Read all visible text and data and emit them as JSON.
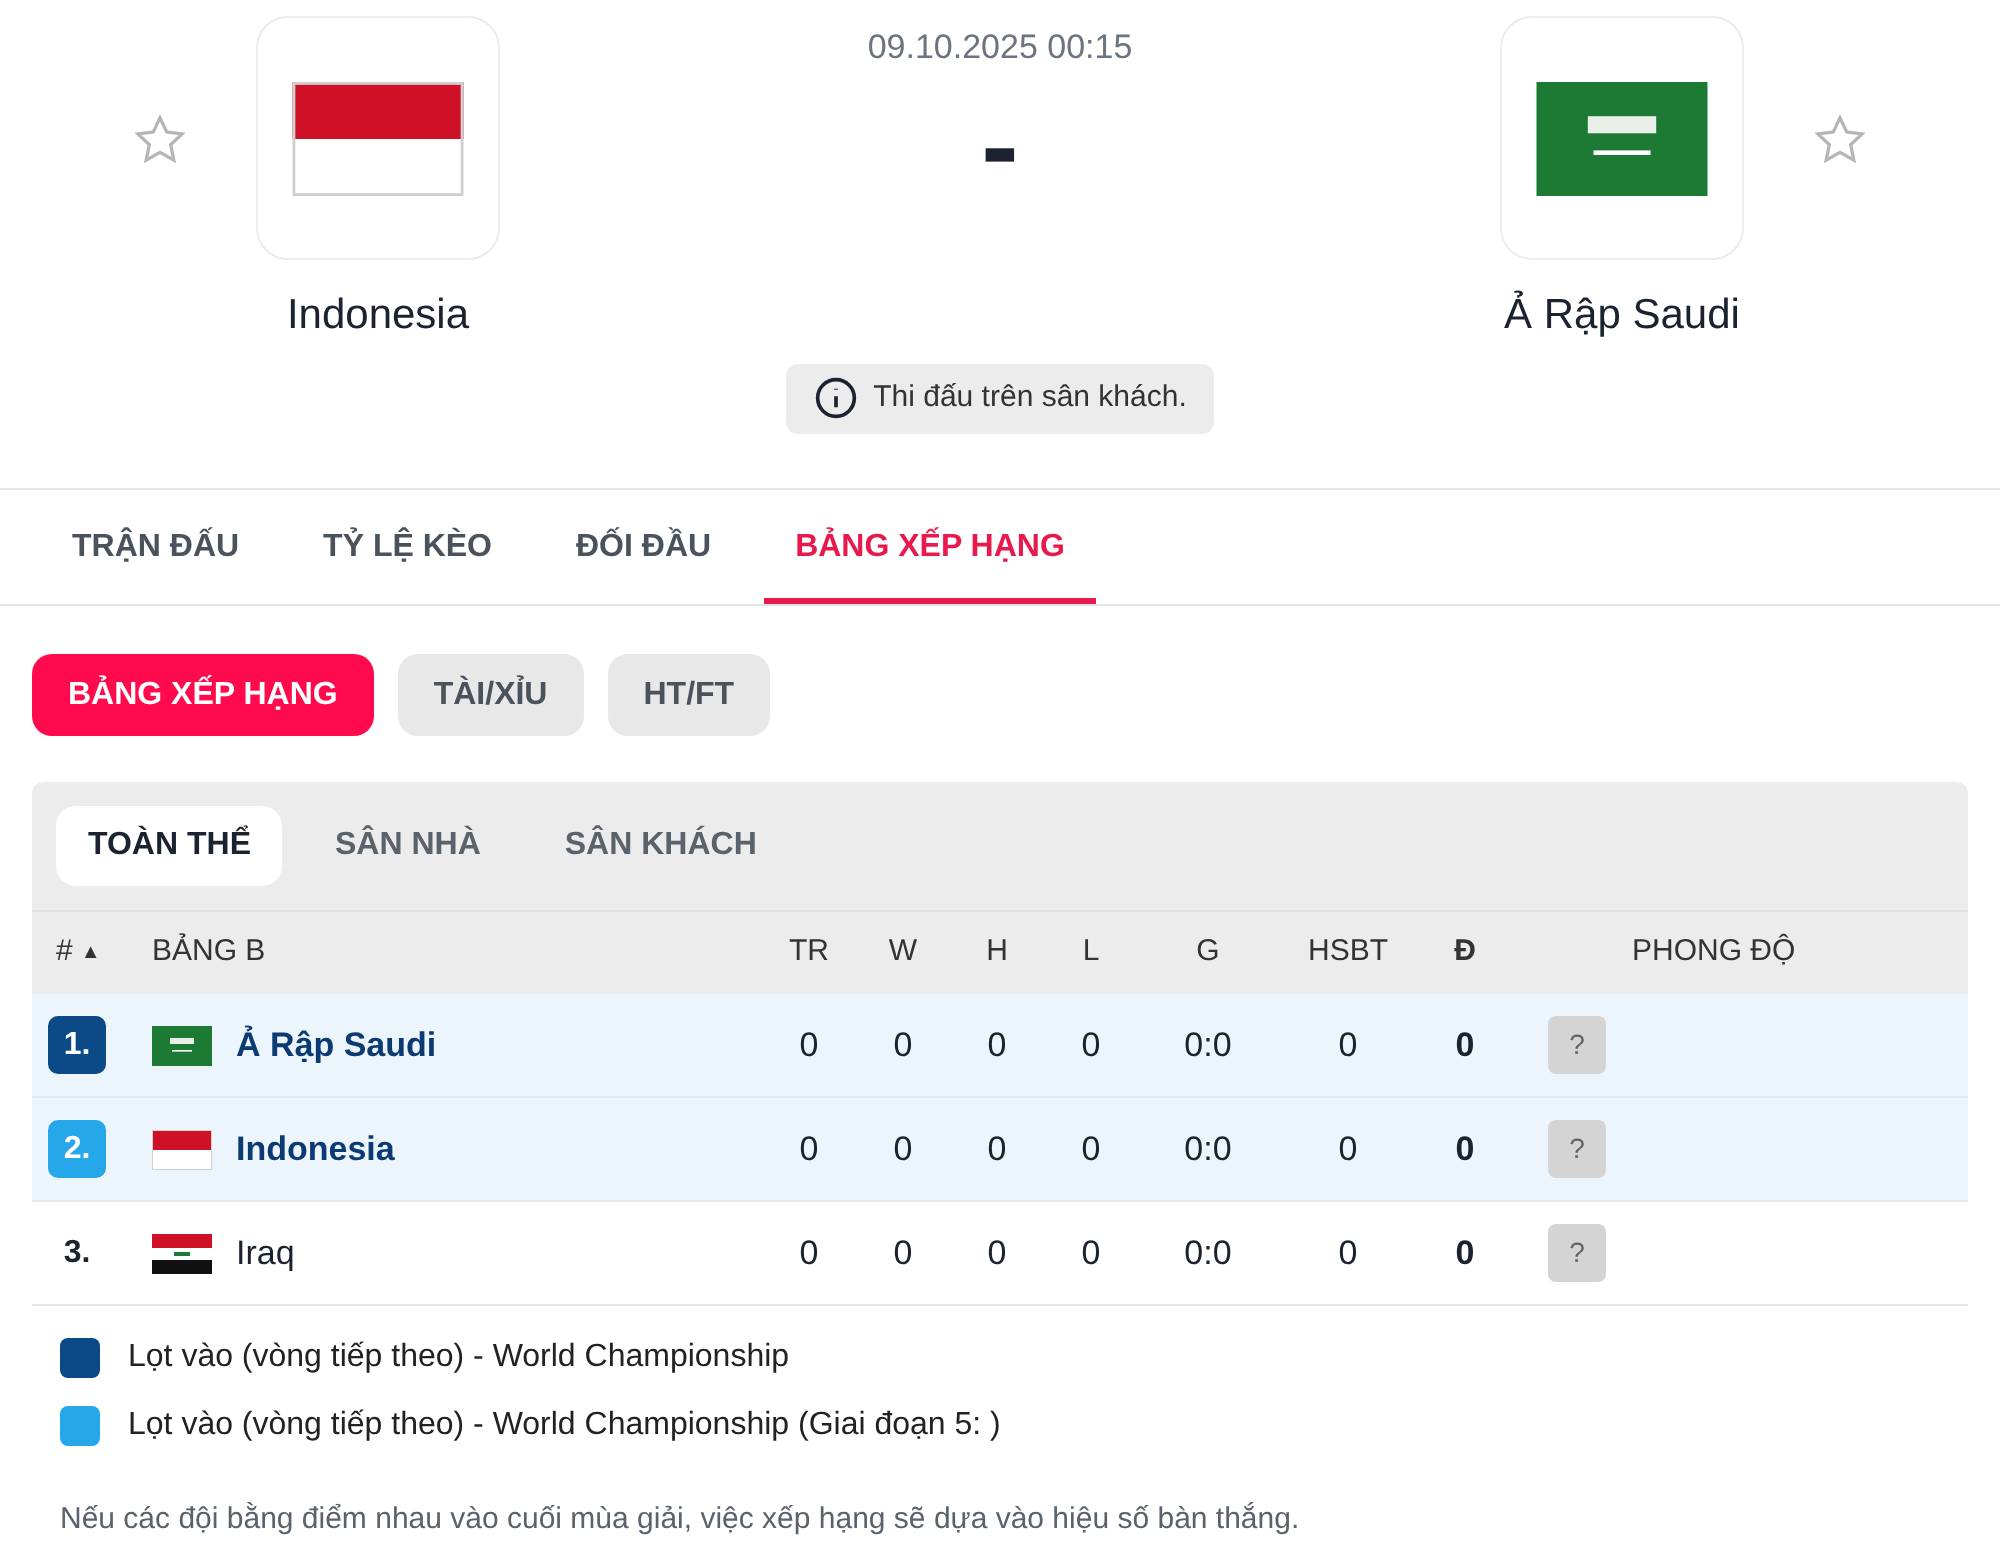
{
  "match": {
    "datetime": "09.10.2025 00:15",
    "score": "-",
    "home": {
      "name": "Indonesia",
      "flag": {
        "kind": "indonesia"
      },
      "favorite": false
    },
    "away": {
      "name": "Ả Rập Saudi",
      "flag": {
        "kind": "saudi"
      },
      "favorite": false
    },
    "info": "Thi đấu trên sân khách."
  },
  "tabs": [
    {
      "label": "TRẬN ĐẤU",
      "selected": false
    },
    {
      "label": "TỶ LỆ KÈO",
      "selected": false
    },
    {
      "label": "ĐỐI ĐẦU",
      "selected": false
    },
    {
      "label": "BẢNG XẾP HẠNG",
      "selected": true
    }
  ],
  "pills": [
    {
      "label": "BẢNG XẾP HẠNG",
      "selected": true
    },
    {
      "label": "TÀI/XỈU",
      "selected": false
    },
    {
      "label": "HT/FT",
      "selected": false
    }
  ],
  "subtabs": [
    {
      "label": "TOÀN THỂ",
      "selected": true
    },
    {
      "label": "SÂN NHÀ",
      "selected": false
    },
    {
      "label": "SÂN KHÁCH",
      "selected": false
    }
  ],
  "table": {
    "rank_header": "#",
    "sort_indicator": "▲",
    "group": "BẢNG B",
    "columns": [
      "TR",
      "W",
      "H",
      "L",
      "G",
      "HSBT",
      "Đ"
    ],
    "form_header": "PHONG ĐỘ",
    "rows": [
      {
        "rank": "1.",
        "color": "#0c4a87",
        "highlighted": true,
        "flag": {
          "kind": "saudi"
        },
        "team": "Ả Rập Saudi",
        "values": [
          "0",
          "0",
          "0",
          "0",
          "0:0",
          "0",
          "0"
        ],
        "form": "?"
      },
      {
        "rank": "2.",
        "color": "#26a7ea",
        "highlighted": true,
        "flag": {
          "kind": "indonesia"
        },
        "team": "Indonesia",
        "values": [
          "0",
          "0",
          "0",
          "0",
          "0:0",
          "0",
          "0"
        ],
        "form": "?"
      },
      {
        "rank": "3.",
        "highlighted": false,
        "flag": {
          "kind": "iraq"
        },
        "team": "Iraq",
        "values": [
          "0",
          "0",
          "0",
          "0",
          "0:0",
          "0",
          "0"
        ],
        "form": "?"
      }
    ]
  },
  "legend": [
    {
      "color": "#0c4a87",
      "label": "Lọt vào (vòng tiếp theo) - World Championship"
    },
    {
      "color": "#26a7ea",
      "label": "Lọt vào (vòng tiếp theo) - World Championship (Giai đoạn 5: )"
    }
  ],
  "note": "Nếu các đội bằng điểm nhau vào cuối mùa giải, việc xếp hạng sẽ dựa vào hiệu số bàn thắng."
}
